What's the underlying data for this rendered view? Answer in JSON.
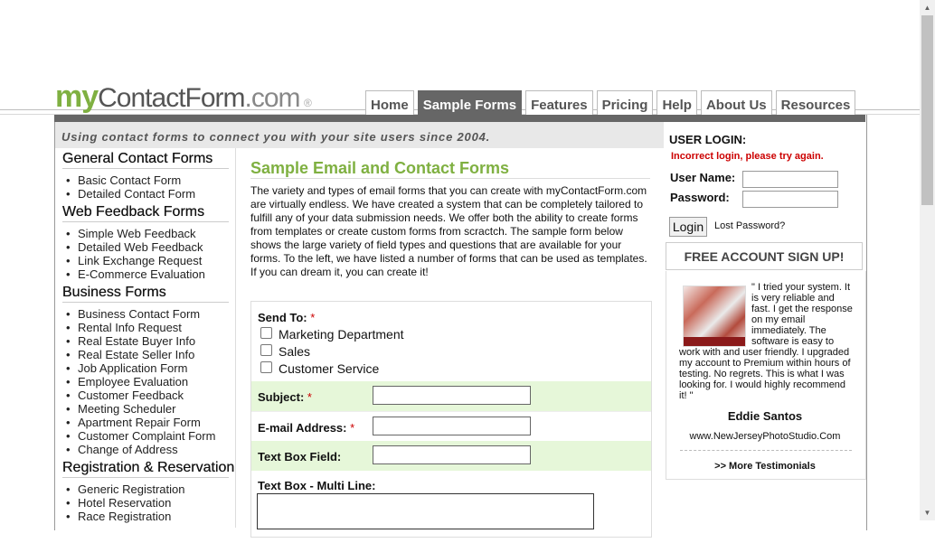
{
  "logo": {
    "my": "my",
    "contactform": "ContactForm",
    "com": ".com",
    "reg": "®"
  },
  "tabs": [
    "Home",
    "Sample Forms",
    "Features",
    "Pricing",
    "Help",
    "About Us",
    "Resources"
  ],
  "tagline": "Using contact forms to connect you with your site users since 2004.",
  "leftnav": {
    "sections": [
      {
        "title": "General Contact Forms",
        "items": [
          "Basic Contact Form",
          "Detailed Contact Form"
        ]
      },
      {
        "title": "Web Feedback Forms",
        "items": [
          "Simple Web Feedback",
          "Detailed Web Feedback",
          "Link Exchange Request",
          "E-Commerce Evaluation"
        ]
      },
      {
        "title": "Business Forms",
        "items": [
          "Business Contact Form",
          "Rental Info Request",
          "Real Estate Buyer Info",
          "Real Estate Seller Info",
          "Job Application Form",
          "Employee Evaluation",
          "Customer Feedback",
          "Meeting Scheduler",
          "Apartment Repair Form",
          "Customer Complaint Form",
          "Change of Address"
        ]
      },
      {
        "title": "Registration & Reservation",
        "items": [
          "Generic Registration",
          "Hotel Reservation",
          "Race Registration"
        ]
      }
    ]
  },
  "main": {
    "title": "Sample Email and Contact Forms",
    "description": "The variety and types of email forms that you can create with myContactForm.com are virtually endless. We have created a system that can be completely tailored to fulfill any of your data submission needs. We offer both the ability to create forms from templates or create custom forms from scractch. The sample form below shows the large variety of field types and questions that are available for your forms. To the left, we have listed a number of forms that can be used as templates. If you can dream it, you can create it!",
    "form": {
      "send_to_label": "Send To:",
      "required_mark": "*",
      "send_to_options": [
        "Marketing Department",
        "Sales",
        "Customer Service"
      ],
      "subject_label": "Subject:",
      "email_label": "E-mail Address:",
      "textbox_label": "Text Box Field:",
      "multiline_label": "Text Box - Multi Line:"
    }
  },
  "login": {
    "title": "USER LOGIN:",
    "error": "Incorrect login, please try again.",
    "username_label": "User Name:",
    "password_label": "Password:",
    "button": "Login",
    "lost_password": "Lost Password?"
  },
  "signup": "FREE ACCOUNT SIGN UP!",
  "testimonial": {
    "text": "\" I tried your system. It is very reliable and fast. I get the response on my email immediately. The software is easy to work with and user friendly. I upgraded my account to Premium within hours of testing. No regrets. This is what I was looking for. I would highly recommend it! \"",
    "name": "Eddie Santos",
    "site": "www.NewJerseyPhotoStudio.Com",
    "more": ">> More Testimonials"
  }
}
